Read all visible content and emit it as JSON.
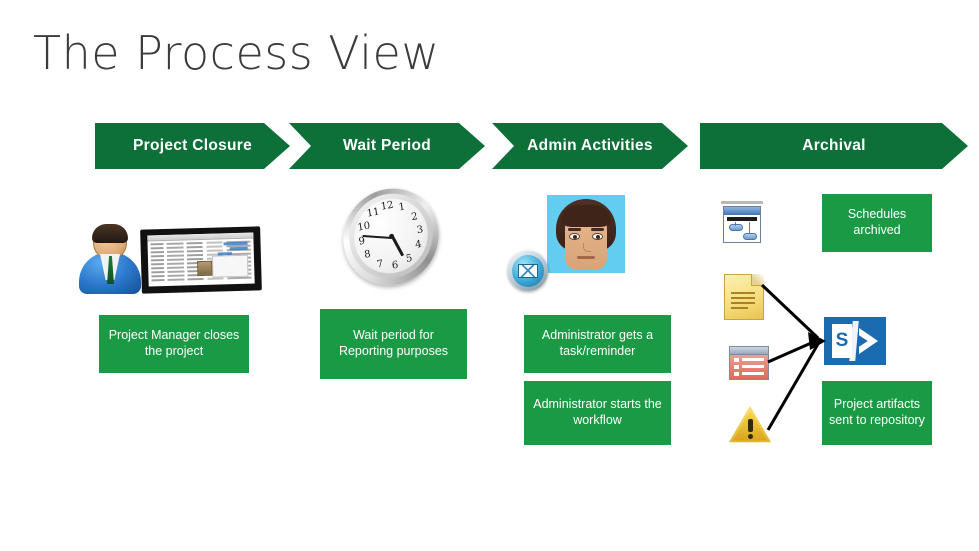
{
  "slide": {
    "title": "The Process View",
    "background_color": "#ffffff"
  },
  "colors": {
    "chevron_green": "#0c7038",
    "box_green": "#1a9a45",
    "title_text": "#3b3b3b",
    "box_text": "#ffffff",
    "arrow_black": "#000000",
    "sharepoint_blue": "#1a6bb0"
  },
  "phases": [
    {
      "label": "Project Closure",
      "name": "phase-project-closure"
    },
    {
      "label": "Wait Period",
      "name": "phase-wait-period"
    },
    {
      "label": "Admin Activities",
      "name": "phase-admin-activities"
    },
    {
      "label": "Archival",
      "name": "phase-archival"
    }
  ],
  "boxes": [
    {
      "text": "Project Manager closes the project",
      "name": "box-project-manager-closes"
    },
    {
      "text": "Wait period for Reporting purposes",
      "name": "box-wait-period-reporting"
    },
    {
      "text": "Administrator gets a task/reminder",
      "name": "box-administrator-task-reminder"
    },
    {
      "text": "Administrator starts the workflow",
      "name": "box-administrator-starts-workflow"
    },
    {
      "text": "Schedules archived",
      "name": "box-schedules-archived"
    },
    {
      "text": "Project artifacts sent to repository",
      "name": "box-project-artifacts-repository"
    }
  ],
  "icons": [
    {
      "name": "businessman-avatar-icon",
      "label": "Project manager avatar"
    },
    {
      "name": "monitor-spreadsheet-icon",
      "label": "Monitor showing project schedule"
    },
    {
      "name": "wall-clock-icon",
      "label": "Wall clock"
    },
    {
      "name": "email-badge-icon",
      "label": "Email notification"
    },
    {
      "name": "admin-face-avatar-icon",
      "label": "Administrator avatar"
    },
    {
      "name": "diagram-window-icon",
      "label": "Schedule diagram"
    },
    {
      "name": "document-icon",
      "label": "Document artifact"
    },
    {
      "name": "list-window-icon",
      "label": "List artifact"
    },
    {
      "name": "warning-triangle-icon",
      "label": "Issue/risk artifact"
    },
    {
      "name": "sharepoint-logo-icon",
      "label": "SharePoint repository"
    }
  ],
  "clock": {
    "numerals": [
      "12",
      "1",
      "2",
      "3",
      "4",
      "5",
      "6",
      "7",
      "8",
      "9",
      "10",
      "11"
    ],
    "hour_hand_deg": 70,
    "minute_hand_deg": 10
  }
}
